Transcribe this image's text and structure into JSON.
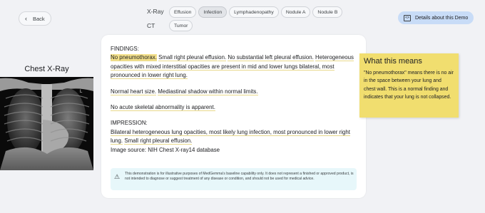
{
  "nav": {
    "back_label": "Back"
  },
  "selector": {
    "xray_label": "X-Ray",
    "ct_label": "CT",
    "xray_options": [
      "Effusion",
      "Infection",
      "Lymphadenopathy",
      "Nodule A",
      "Nodule B"
    ],
    "ct_options": [
      "Tumor"
    ],
    "selected": "Infection"
  },
  "details_button": {
    "label": "Details about this Demo",
    "icon": "code-icon"
  },
  "image_panel": {
    "title": "Chest X-Ray",
    "image_alt": "chest x-ray image"
  },
  "report": {
    "findings_heading": "FINDINGS:",
    "findings": [
      {
        "text": "No pneumothorax.",
        "highlight": "yellow"
      },
      {
        "text": "Small right pleural effusion.",
        "highlight": "underline"
      },
      {
        "text": "No substantial left pleural effusion.",
        "highlight": "underline"
      },
      {
        "text": "Heterogeneous opacities with mixed interstitial opacities are present in mid and lower lungs bilateral, most pronounced in lower right lung.",
        "highlight": "underline"
      }
    ],
    "heart": [
      {
        "text": "Normal heart size.",
        "highlight": "underline"
      },
      {
        "text": "Mediastinal shadow within normal limits.",
        "highlight": "underline"
      }
    ],
    "skeletal": [
      {
        "text": "No acute skeletal abnormality is apparent.",
        "highlight": "underline"
      }
    ],
    "impression_heading": "IMPRESSION:",
    "impression": [
      {
        "text": "Bilateral heterogeneous lung opacities, most likely lung infection, most pronounced in lower right lung.",
        "highlight": "underline"
      },
      {
        "text": "Small right pleural effusion.",
        "highlight": "underline"
      }
    ],
    "source": "Image source: NIH Chest X-ray14 database"
  },
  "disclaimer": {
    "icon": "warning-icon",
    "text": "This demonstration is for illustrative purposes of MedGemma's baseline capability only. It does not represent a finished or approved product, is not intended to diagnose or suggest treatment of any disease or condition, and should not be used for medical advice."
  },
  "explanation": {
    "title": "What this means",
    "body": "\"No pneumothorax\" means there is no air in the space between your lung and chest wall. This is a normal finding and indicates that your lung is not collapsed."
  },
  "colors": {
    "background": "#f1f2f5",
    "note_yellow": "#f1de6f",
    "highlight_yellow": "#f3e08b",
    "details_button": "#c8dcf7",
    "disclaimer_bg": "#e7f7fa"
  }
}
